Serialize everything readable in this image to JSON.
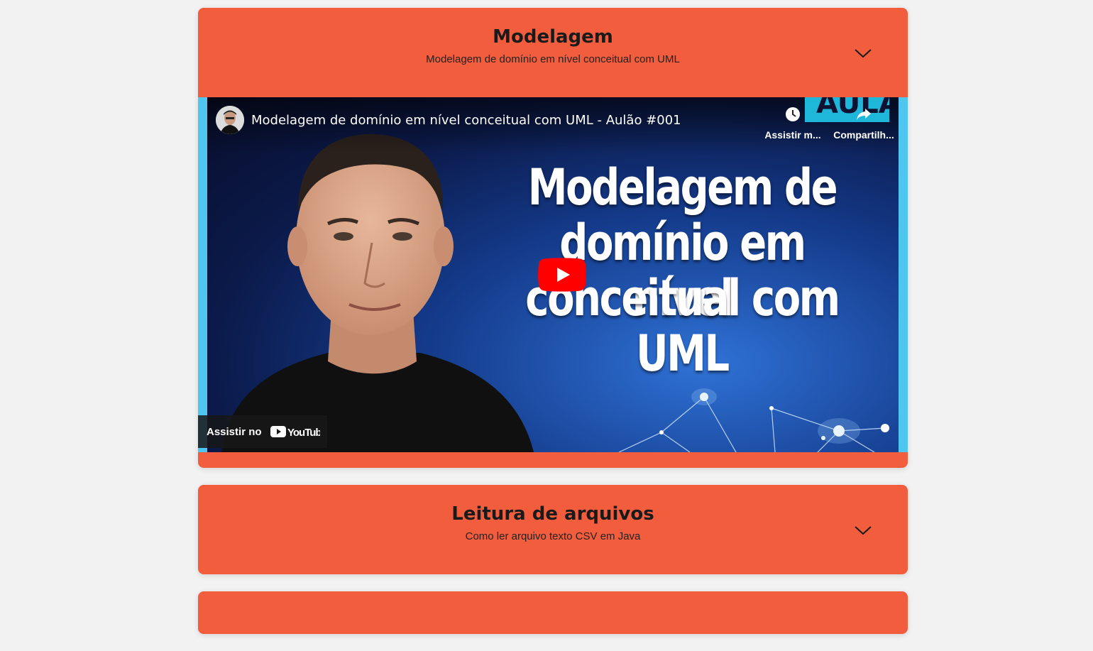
{
  "cards": [
    {
      "title": "Modelagem",
      "subtitle": "Modelagem de domínio em nível conceitual com UML",
      "expanded": true,
      "video": {
        "title": "Modelagem de domínio em nível conceitual com UML - Aulão #001",
        "watch_later_label": "Assistir m...",
        "share_label": "Compartilh...",
        "thumbnail_lines": [
          "Modelagem de",
          "domínio em nível",
          "conceitual com UML"
        ],
        "badge_text": "AULÃO",
        "watch_on_label": "Assistir no",
        "youtube_logo_text": "YouTube"
      }
    },
    {
      "title": "Leitura de arquivos",
      "subtitle": "Como ler arquivo texto CSV em Java",
      "expanded": false
    }
  ],
  "colors": {
    "card": "#f25e3d",
    "page_bg": "#f2f2f2",
    "play_red": "#ff0000"
  }
}
